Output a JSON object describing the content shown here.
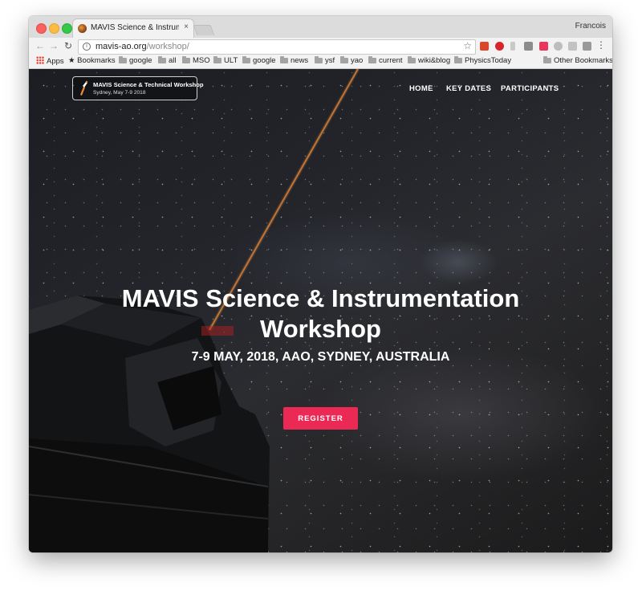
{
  "browser": {
    "tab_title": "MAVIS Science & Instrumentati",
    "tab_close": "×",
    "user_name": "Francois",
    "url_domain": "mavis-ao.org",
    "url_path": "/workshop/",
    "bookmarks": [
      "Apps",
      "Bookmarks",
      "google",
      "all",
      "MSO",
      "ULT",
      "google",
      "news",
      "ysf",
      "yao",
      "current",
      "wiki&blog",
      "PhysicsToday"
    ],
    "other_bookmarks": "Other Bookmarks"
  },
  "site": {
    "logo_line1": "MAVIS Science & Technical Workshop",
    "logo_line2": "Sydney, May 7-9 2018",
    "nav": [
      "HOME",
      "KEY DATES",
      "PARTICIPANTS"
    ],
    "headline_line1": "MAVIS Science & Instrumentation",
    "headline_line2": "Workshop",
    "subheading": "7-9 MAY, 2018, AAO, SYDNEY, AUSTRALIA",
    "register_label": "REGISTER",
    "accent_color": "#ea2a55"
  }
}
